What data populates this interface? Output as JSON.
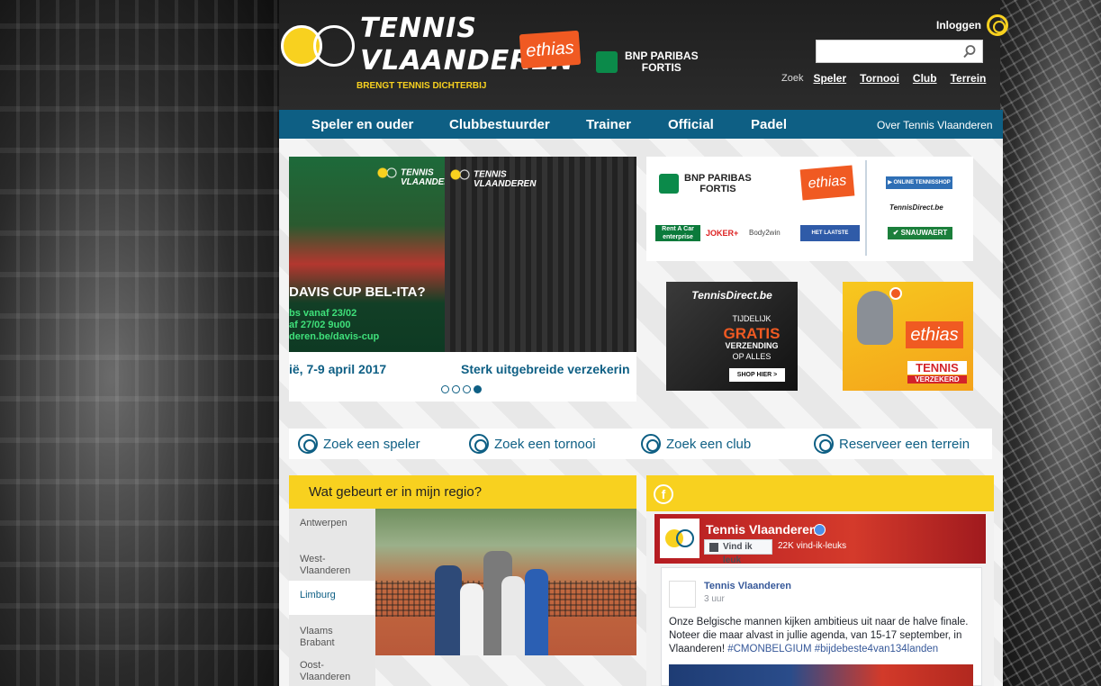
{
  "header": {
    "logo": {
      "line1": "TENNIS",
      "line2": "VLAANDEREN",
      "tagline": "BRENGT TENNIS DICHTERBIJ"
    },
    "sponsor_ethias": "ethias",
    "sponsor_bnp": {
      "line1": "BNP PARIBAS",
      "line2": "FORTIS"
    },
    "login_label": "Inloggen",
    "search": {
      "value": "",
      "placeholder": ""
    },
    "search_links": {
      "label": "Zoek",
      "items": [
        "Speler",
        "Tornooi",
        "Club",
        "Terrein"
      ]
    }
  },
  "nav": {
    "items": [
      "Speler en ouder",
      "Clubbestuurder",
      "Trainer",
      "Official",
      "Padel"
    ],
    "about": "Over Tennis Vlaanderen"
  },
  "carousel": {
    "slide_logo": {
      "line1": "TENNIS",
      "line2": "VLAANDEREN"
    },
    "slide1_title": "DAVIS CUP BEL-ITA?",
    "slide1_lines": [
      "bs vanaf 23/02",
      "af 27/02 9u00",
      "deren.be/davis-cup"
    ],
    "caption1": "ië, 7-9 april 2017",
    "caption2": "Sterk uitgebreide verzekerin",
    "dots": 4,
    "active_dot": 4
  },
  "sponsors_box": {
    "bnp": {
      "line1": "BNP PARIBAS",
      "line2": "FORTIS"
    },
    "ethias": "ethias",
    "shop": "▶ ONLINE TENNISSHOP",
    "tennisdirect": "TennisDirect.be",
    "snauwaert": "✔ SNAUWAERT",
    "rentacar": "Rent A Car enterprise",
    "joker": "JOKER+",
    "body2win": "Body2win",
    "hln": "HET LAATSTE NIEUWS"
  },
  "ad_tennisdirect": {
    "brand": "TennisDirect.be",
    "line1": "TIJDELIJK",
    "line2": "GRATIS",
    "line3": "VERZENDING",
    "line4": "OP ALLES",
    "button": "SHOP HIER >"
  },
  "ad_ethias": {
    "brand": "ethias",
    "line1": "TENNIS",
    "line2": "VERZEKERD"
  },
  "quick_links": [
    "Zoek een speler",
    "Zoek een tornooi",
    "Zoek een club",
    "Reserveer een terrein"
  ],
  "region": {
    "title": "Wat gebeurt er in mijn regio?",
    "items": [
      {
        "label": "Antwerpen",
        "active": false
      },
      {
        "label": "West-Vlaanderen",
        "active": false
      },
      {
        "label": "Limburg",
        "active": true
      },
      {
        "label": "Vlaams Brabant",
        "active": false
      },
      {
        "label": "Oost-Vlaanderen",
        "active": false
      }
    ]
  },
  "facebook": {
    "icon": "f",
    "page_name": "Tennis Vlaanderen",
    "like_button": "Vind ik leuk",
    "like_count": "22K vind-ik-leuks",
    "post": {
      "author": "Tennis Vlaanderen",
      "time": "3 uur",
      "text": "Onze Belgische mannen kijken ambitieus uit naar de halve finale. Noteer die maar alvast in jullie agenda, van 15-17 september, in Vlaanderen!",
      "hashtags": "#CMONBELGIUM #bijdebeste4van134landen"
    }
  },
  "colors": {
    "brand_blue": "#0e5f84",
    "brand_yellow": "#f8d11f",
    "ethias_orange": "#f05a22"
  }
}
